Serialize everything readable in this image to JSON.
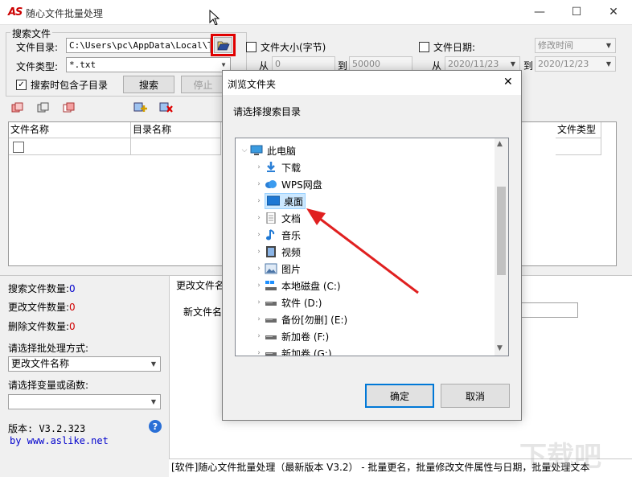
{
  "app": {
    "logo": "AS",
    "title": "随心文件批量处理",
    "minimize": "—",
    "maximize": "☐",
    "close": "✕"
  },
  "search": {
    "group_label": "搜索文件",
    "dir_label": "文件目录:",
    "dir_value": "C:\\Users\\pc\\AppData\\Local\\Temp",
    "type_label": "文件类型:",
    "type_value": "*.txt",
    "include_sub_label": "搜索时包含子目录",
    "include_sub_checked": true,
    "search_button": "搜索",
    "stop_button": "停止",
    "size_label": "文件大小(字节)",
    "from_label": "从",
    "to_label": "到",
    "size_from": "0",
    "size_to": "50000",
    "date_label": "文件日期:",
    "date_mode": "修改时间",
    "date_from_label": "从",
    "date_to_label": "到",
    "date_from": "2020/11/23",
    "date_to": "2020/12/23"
  },
  "list": {
    "columns": [
      "文件名称",
      "目录名称",
      "文件类型"
    ]
  },
  "stats": {
    "search_count_label": "搜索文件数量:",
    "search_count": "0",
    "changed_count_label": "更改文件数量:",
    "changed_count": "0",
    "deleted_count_label": "删除文件数量:",
    "deleted_count": "0",
    "mode_label": "请选择批处理方式:",
    "mode_value": "更改文件名称",
    "var_label": "请选择变量或函数:",
    "var_value": "",
    "version_label": "版本: V3.2.323",
    "website": "by www.aslike.net",
    "help": "?"
  },
  "rename": {
    "tab_label": "更改文件名",
    "newname_label": "新文件名"
  },
  "dialog": {
    "title": "浏览文件夹",
    "close": "✕",
    "prompt": "请选择搜索目录",
    "root": "此电脑",
    "items": [
      {
        "label": "下载",
        "icon": "download-icon"
      },
      {
        "label": "WPS网盘",
        "icon": "cloud-icon"
      },
      {
        "label": "桌面",
        "icon": "desktop-icon",
        "selected": true
      },
      {
        "label": "文档",
        "icon": "document-icon"
      },
      {
        "label": "音乐",
        "icon": "music-icon"
      },
      {
        "label": "视频",
        "icon": "video-icon"
      },
      {
        "label": "图片",
        "icon": "picture-icon"
      },
      {
        "label": "本地磁盘 (C:)",
        "icon": "windows-drive-icon"
      },
      {
        "label": "软件 (D:)",
        "icon": "drive-icon"
      },
      {
        "label": "备份[勿删] (E:)",
        "icon": "drive-icon"
      },
      {
        "label": "新加卷 (F:)",
        "icon": "drive-icon"
      },
      {
        "label": "新加卷 (G:)",
        "icon": "drive-icon"
      }
    ],
    "ok_button": "确定",
    "cancel_button": "取消"
  },
  "statusbar": {
    "text": "[软件]随心文件批量处理（最新版本 V3.2） - 批量更名，批量修改文件属性与日期，批量处理文本"
  },
  "colors": {
    "highlight_box": "#e00000",
    "arrow": "#e02020",
    "selection": "#cce8ff",
    "count_color": "#d00000",
    "link_color": "#0000cc"
  }
}
